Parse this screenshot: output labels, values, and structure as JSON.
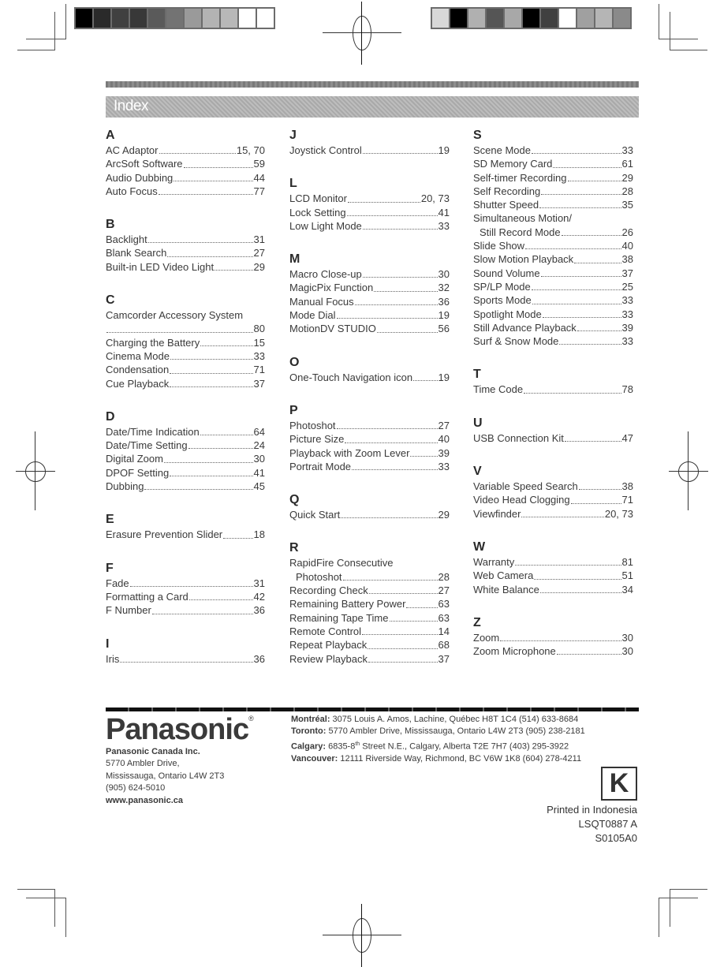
{
  "header": {
    "title": "Index"
  },
  "color_bars": {
    "left": [
      "#000000",
      "#2a2a2a",
      "#404040",
      "#383838",
      "#5a5a5a",
      "#737373",
      "#9a9a9a",
      "#b3b3b3",
      "#b8b8b8",
      "#ffffff",
      "#ffffff"
    ],
    "right": [
      "#d8d8d8",
      "#000000",
      "#b0b0b0",
      "#555555",
      "#a8a8a8",
      "#000000",
      "#404040",
      "#ffffff",
      "#a0a0a0",
      "#b5b5b5",
      "#8a8a8a"
    ]
  },
  "index": {
    "columns": [
      {
        "sections": [
          {
            "letter": "A",
            "entries": [
              {
                "label": "AC Adaptor",
                "page": "15, 70"
              },
              {
                "label": "ArcSoft Software",
                "page": "59"
              },
              {
                "label": "Audio Dubbing",
                "page": "44"
              },
              {
                "label": "Auto Focus",
                "page": "77"
              }
            ]
          },
          {
            "letter": "B",
            "entries": [
              {
                "label": "Backlight",
                "page": "31"
              },
              {
                "label": "Blank Search",
                "page": "27"
              },
              {
                "label": "Built-in LED Video Light",
                "page": "29"
              }
            ]
          },
          {
            "letter": "C",
            "entries": [
              {
                "label": "Camcorder Accessory System",
                "page": "",
                "wrap": true
              },
              {
                "label": "",
                "page": "80",
                "continuation": true
              },
              {
                "label": "Charging the Battery",
                "page": "15"
              },
              {
                "label": "Cinema Mode",
                "page": "33"
              },
              {
                "label": "Condensation",
                "page": "71"
              },
              {
                "label": "Cue Playback",
                "page": "37"
              }
            ]
          },
          {
            "letter": "D",
            "entries": [
              {
                "label": "Date/Time Indication",
                "page": "64"
              },
              {
                "label": "Date/Time Setting",
                "page": "24"
              },
              {
                "label": "Digital Zoom",
                "page": "30"
              },
              {
                "label": "DPOF Setting",
                "page": "41"
              },
              {
                "label": "Dubbing",
                "page": "45"
              }
            ]
          },
          {
            "letter": "E",
            "entries": [
              {
                "label": "Erasure Prevention Slider",
                "page": "18"
              }
            ]
          },
          {
            "letter": "F",
            "entries": [
              {
                "label": "Fade",
                "page": "31"
              },
              {
                "label": "Formatting a Card",
                "page": "42"
              },
              {
                "label": "F Number",
                "page": "36"
              }
            ]
          },
          {
            "letter": "I",
            "entries": [
              {
                "label": "Iris",
                "page": "36"
              }
            ]
          }
        ]
      },
      {
        "sections": [
          {
            "letter": "J",
            "entries": [
              {
                "label": "Joystick Control",
                "page": "19"
              }
            ]
          },
          {
            "letter": "L",
            "entries": [
              {
                "label": "LCD Monitor",
                "page": "20, 73"
              },
              {
                "label": "Lock Setting",
                "page": "41"
              },
              {
                "label": "Low Light Mode",
                "page": "33"
              }
            ]
          },
          {
            "letter": "M",
            "entries": [
              {
                "label": "Macro Close-up",
                "page": "30"
              },
              {
                "label": "MagicPix Function",
                "page": "32"
              },
              {
                "label": "Manual Focus",
                "page": "36"
              },
              {
                "label": "Mode Dial",
                "page": "19"
              },
              {
                "label": "MotionDV STUDIO",
                "page": "56"
              }
            ]
          },
          {
            "letter": "O",
            "entries": [
              {
                "label": "One-Touch Navigation icon",
                "page": "19"
              }
            ]
          },
          {
            "letter": "P",
            "entries": [
              {
                "label": "Photoshot",
                "page": "27"
              },
              {
                "label": "Picture Size",
                "page": "40"
              },
              {
                "label": "Playback with Zoom Lever",
                "page": "39"
              },
              {
                "label": "Portrait Mode",
                "page": "33"
              }
            ]
          },
          {
            "letter": "Q",
            "entries": [
              {
                "label": "Quick Start",
                "page": "29"
              }
            ]
          },
          {
            "letter": "R",
            "entries": [
              {
                "label": "RapidFire Consecutive",
                "page": "",
                "wrap": true
              },
              {
                "label": "Photoshot",
                "page": "28",
                "indent": true
              },
              {
                "label": "Recording Check",
                "page": "27"
              },
              {
                "label": "Remaining Battery Power",
                "page": "63"
              },
              {
                "label": "Remaining Tape Time",
                "page": "63"
              },
              {
                "label": "Remote Control",
                "page": "14"
              },
              {
                "label": "Repeat Playback",
                "page": "68"
              },
              {
                "label": "Review Playback",
                "page": "37"
              }
            ]
          }
        ]
      },
      {
        "sections": [
          {
            "letter": "S",
            "entries": [
              {
                "label": "Scene Mode",
                "page": "33"
              },
              {
                "label": "SD Memory Card",
                "page": "61"
              },
              {
                "label": "Self-timer Recording",
                "page": "29"
              },
              {
                "label": "Self Recording",
                "page": "28"
              },
              {
                "label": "Shutter Speed",
                "page": "35"
              },
              {
                "label": "Simultaneous Motion/",
                "page": "",
                "wrap": true
              },
              {
                "label": "Still Record Mode",
                "page": "26",
                "indent": true
              },
              {
                "label": "Slide Show",
                "page": "40"
              },
              {
                "label": "Slow Motion Playback",
                "page": "38"
              },
              {
                "label": "Sound Volume",
                "page": "37"
              },
              {
                "label": "SP/LP Mode",
                "page": "25"
              },
              {
                "label": "Sports Mode",
                "page": "33"
              },
              {
                "label": "Spotlight Mode",
                "page": "33"
              },
              {
                "label": "Still Advance Playback",
                "page": "39"
              },
              {
                "label": "Surf & Snow Mode",
                "page": "33"
              }
            ]
          },
          {
            "letter": "T",
            "entries": [
              {
                "label": "Time Code",
                "page": "78"
              }
            ]
          },
          {
            "letter": "U",
            "entries": [
              {
                "label": "USB Connection Kit",
                "page": "47"
              }
            ]
          },
          {
            "letter": "V",
            "entries": [
              {
                "label": "Variable Speed Search",
                "page": "38"
              },
              {
                "label": "Video Head Clogging",
                "page": "71"
              },
              {
                "label": "Viewfinder",
                "page": "20, 73"
              }
            ]
          },
          {
            "letter": "W",
            "entries": [
              {
                "label": "Warranty",
                "page": "81"
              },
              {
                "label": "Web Camera",
                "page": "51"
              },
              {
                "label": "White Balance",
                "page": "34"
              }
            ]
          },
          {
            "letter": "Z",
            "entries": [
              {
                "label": "Zoom",
                "page": "30"
              },
              {
                "label": "Zoom Microphone",
                "page": "30"
              }
            ]
          }
        ]
      }
    ]
  },
  "footer": {
    "logo": "Panasonic",
    "registered": "®",
    "company": {
      "name": "Panasonic Canada Inc.",
      "address_1": "5770 Ambler Drive,",
      "address_2": "Mississauga, Ontario L4W 2T3",
      "phone": "(905) 624-5010",
      "website": "www.panasonic.ca"
    },
    "branches": [
      {
        "city": "Montréal:",
        "detail": " 3075 Louis A. Amos, Lachine, Québec H8T 1C4 (514) 633-8684"
      },
      {
        "city": "Toronto:",
        "detail": " 5770 Ambler Drive, Mississauga, Ontario L4W 2T3 (905) 238-2181"
      },
      {
        "city": "Calgary:",
        "detail_pre": " 6835-8",
        "sup": "th",
        "detail": " Street N.E., Calgary, Alberta T2E 7H7 (403) 295-3922"
      },
      {
        "city": "Vancouver:",
        "detail": " 12111 Riverside Way, Richmond, BC V6W 1K8 (604) 278-4211"
      }
    ],
    "region_mark": "K",
    "printed_in": "Printed in Indonesia",
    "model_code": "LSQT0887 A",
    "print_code": "S0105A0"
  }
}
